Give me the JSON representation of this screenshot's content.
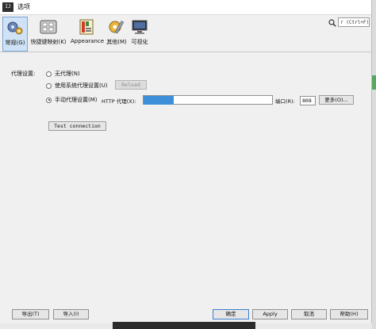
{
  "window": {
    "title": "选项",
    "app_icon": "ij-app-icon"
  },
  "toolbar": {
    "items": [
      {
        "label": "常规(G)",
        "icon": "gears-icon",
        "selected": true
      },
      {
        "label": "快捷键映射(K)",
        "icon": "keyboard-icon",
        "selected": false
      },
      {
        "label": "Appearance",
        "icon": "palette-icon",
        "selected": false
      },
      {
        "label": "其他(M)",
        "icon": "tools-icon",
        "selected": false
      },
      {
        "label": "可视化",
        "icon": "monitor-icon",
        "selected": false
      }
    ],
    "search": {
      "value": "r (Ctrl+F)"
    }
  },
  "proxy": {
    "label": "代理设置:",
    "options": [
      {
        "label": "无代理(N)",
        "selected": false
      },
      {
        "label": "使用系统代理设置(U)",
        "selected": false
      },
      {
        "label": "手动代理设置(M)",
        "selected": true
      }
    ],
    "reload_label": "Reload",
    "http_label": "HTTP 代理(X):",
    "port_label": "端口(R):",
    "port_value": "808",
    "more_label": "更多(O)...",
    "test_label": "Test connection"
  },
  "footer": {
    "export_label": "导出(T)",
    "import_label": "导入(I)",
    "ok_label": "确定",
    "apply_label": "Apply",
    "cancel_label": "取消",
    "help_label": "帮助(H)"
  },
  "colors": {
    "accent": "#3c8fd8",
    "selected_bg": "#cfe2f6"
  }
}
